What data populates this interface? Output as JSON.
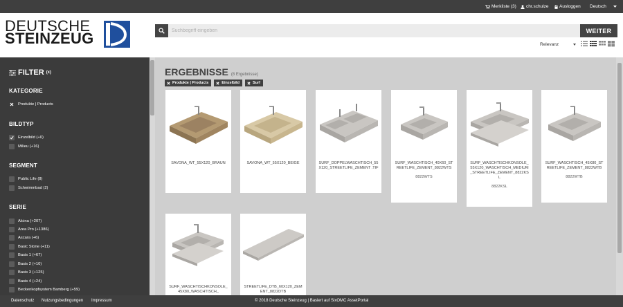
{
  "topbar": {
    "merkliste": "Merkliste (3)",
    "user": "chr.schulze",
    "logout": "Ausloggen",
    "language": "Deutsch"
  },
  "logo": {
    "line1": "DEUTSCHE",
    "line2": "STEINZEUG"
  },
  "search": {
    "placeholder": "Suchbegriff eingeben",
    "button": "WEITER"
  },
  "sort": {
    "selected": "Relevanz"
  },
  "sidebar": {
    "title": "FILTER",
    "title_badge": "(x)",
    "sections": {
      "kategorie": {
        "title": "KATEGORIE",
        "options": [
          "Produkte | Products"
        ]
      },
      "bildtyp": {
        "title": "BILDTYP",
        "options": [
          "Einzelbild (+0)",
          "Milieu (+16)"
        ]
      },
      "segment": {
        "title": "SEGMENT",
        "options": [
          "Public Life (8)",
          "Schwimmbad (2)"
        ]
      },
      "serie": {
        "title": "SERIE",
        "options": [
          "Alcina (+207)",
          "Area Pro (+1386)",
          "Ascara (+6)",
          "Basic Stone (+11)",
          "Basis 1 (+67)",
          "Basis 2 (+10)",
          "Basis 3 (+125)",
          "Basis 4 (+24)",
          "Beckenkopfsystem Bamberg (+59)"
        ]
      }
    }
  },
  "results": {
    "title": "ERGEBNISSE",
    "count": "(8 Ergebnisse)",
    "chips": [
      "Produkte | Products",
      "Einzelbild",
      "Surf"
    ],
    "items": [
      {
        "title": "SAVONA_WT_55X120_BRAUN",
        "code": ""
      },
      {
        "title": "SAVONA_WT_55X120_BEIGE",
        "code": ""
      },
      {
        "title": "SURF_DOPPELWASCHTISCH_55X120_STREETLIFE_ZEMENT .TIF",
        "code": ""
      },
      {
        "title": "SURF_WASCHTISCH_40X60_STREETLIFE_ZEMENT_8822WTS",
        "code": "8822WTS"
      },
      {
        "title": "SURF_WASCHTISCHKONSOLE_55X120_WASCHTISCH_MEDIUM_STREETLIFE_ZEMENT_8822KSL",
        "code": "8822KSL"
      },
      {
        "title": "SURF_WASCHTISCH_45X80_STREETLIFE_ZEMENT_8822WTB",
        "code": "8822WTB"
      },
      {
        "title": "SURF_WASCHTISCHKONSOLE_45X80_WASCHTISCH_",
        "code": ""
      },
      {
        "title": "STREETLIFE_DTB_60X120_ZEMENT_8822DTB",
        "code": ""
      }
    ]
  },
  "footer": {
    "datenschutz": "Datenschutz",
    "nutzung": "Nutzungsbedingungen",
    "impressum": "Impressum",
    "copyright": "© 2018 Deutsche Steinzeug | Basiert auf SixOMC AssetPortal"
  },
  "colors": {
    "dark": "#3b3b3b",
    "brand_blue": "#1f4f9d",
    "background": "#cfcfcf"
  }
}
